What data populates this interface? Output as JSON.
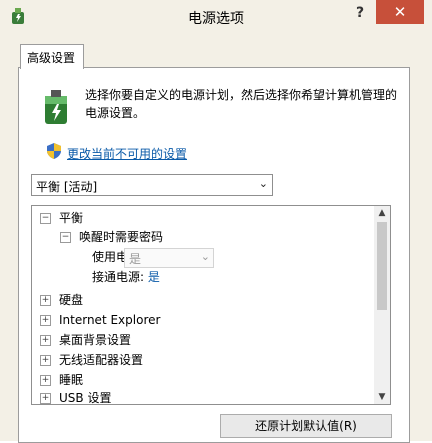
{
  "window": {
    "title": "电源选项",
    "help_label": "?",
    "close_label": "✕"
  },
  "tab": {
    "label": "高级设置"
  },
  "description": "选择你要自定义的电源计划，然后选择你希望计算机管理的电源设置。",
  "link": "更改当前不可用的设置",
  "plan_select": {
    "value": "平衡 [活动]"
  },
  "tree": {
    "root": {
      "toggle": "⊟",
      "label": "平衡"
    },
    "group": {
      "toggle": "⊟",
      "label": "唤醒时需要密码"
    },
    "battery": {
      "label": "使用电池:",
      "value": "是"
    },
    "plugged": {
      "label": "接通电源:",
      "value": "是"
    },
    "items": [
      {
        "toggle": "⊞",
        "label": "硬盘"
      },
      {
        "toggle": "⊞",
        "label": "Internet Explorer"
      },
      {
        "toggle": "⊞",
        "label": "桌面背景设置"
      },
      {
        "toggle": "⊞",
        "label": "无线适配器设置"
      },
      {
        "toggle": "⊞",
        "label": "睡眠"
      },
      {
        "toggle": "⊞",
        "label": "USB 设置"
      }
    ]
  },
  "restore_button": "还原计划默认值(R)"
}
